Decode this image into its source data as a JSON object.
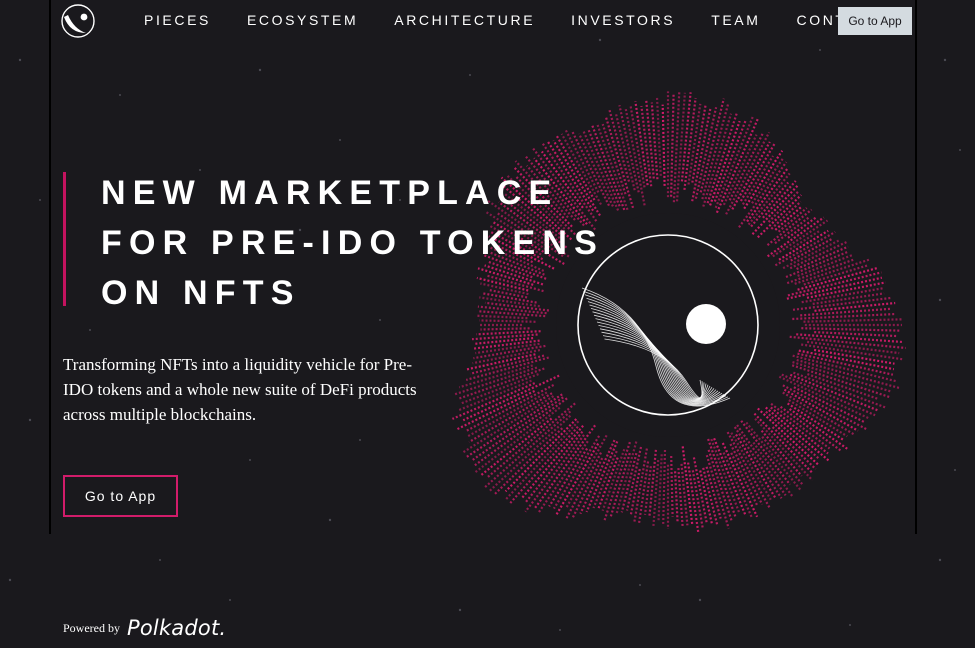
{
  "header": {
    "logo_icon": "moon-logo-icon",
    "nav": [
      {
        "label": "PIECES"
      },
      {
        "label": "ECOSYSTEM"
      },
      {
        "label": "ARCHITECTURE"
      },
      {
        "label": "INVESTORS"
      },
      {
        "label": "TEAM"
      },
      {
        "label": "CONTACT"
      }
    ],
    "cta_label": "Go to App"
  },
  "hero": {
    "headline_lines": [
      "NEW MARKETPLACE",
      "FOR PRE-IDO TOKENS",
      "ON NFTS"
    ],
    "subtitle": "Transforming NFTs into a liquidity vehicle for Pre-IDO tokens and a whole new suite of DeFi products across multiple blockchains.",
    "cta_label": "Go to App",
    "art_icon": "particle-ring-moon-illustration"
  },
  "footer": {
    "powered_label": "Powered by",
    "brand": "Polkadot."
  },
  "colors": {
    "background": "#1a191d",
    "accent": "#d11c6a",
    "button_light": "#d4dbe0",
    "text": "#ffffff"
  }
}
